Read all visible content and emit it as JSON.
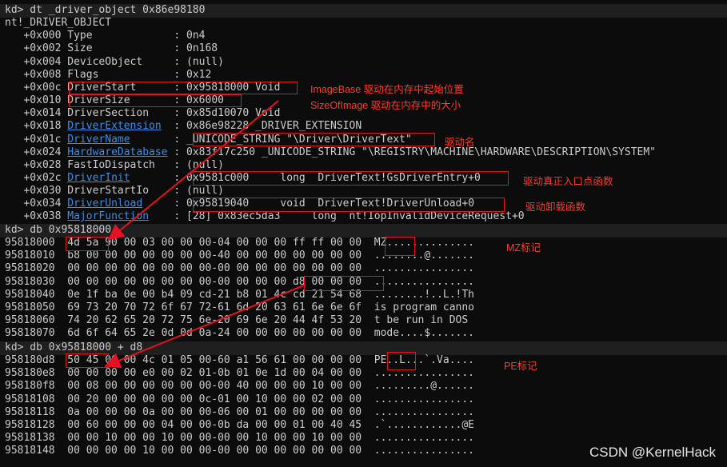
{
  "console": {
    "cmd1": "kd> dt _driver_object 0x86e98180",
    "struct_name": "nt!_DRIVER_OBJECT",
    "fields": [
      {
        "off": "+0x000",
        "name": "Type",
        "val": ": 0n4",
        "link": false
      },
      {
        "off": "+0x002",
        "name": "Size",
        "val": ": 0n168",
        "link": false
      },
      {
        "off": "+0x004",
        "name": "DeviceObject",
        "val": ": (null)",
        "link": false
      },
      {
        "off": "+0x008",
        "name": "Flags",
        "val": ": 0x12",
        "link": false
      },
      {
        "off": "+0x00c",
        "name": "DriverStart",
        "val": ": 0x95818000 Void",
        "link": false
      },
      {
        "off": "+0x010",
        "name": "DriverSize",
        "val": ": 0x6000",
        "link": false
      },
      {
        "off": "+0x014",
        "name": "DriverSection",
        "val": ": 0x85d10070 Void",
        "link": false
      },
      {
        "off": "+0x018",
        "name": "DriverExtension",
        "val": ": 0x86e98228 _DRIVER_EXTENSION",
        "link": true
      },
      {
        "off": "+0x01c",
        "name": "DriverName",
        "val": ": _UNICODE_STRING \"\\Driver\\DriverText\"",
        "link": true
      },
      {
        "off": "+0x024",
        "name": "HardwareDatabase",
        "val": ": 0x83f17c250 _UNICODE_STRING \"\\REGISTRY\\MACHINE\\HARDWARE\\DESCRIPTION\\SYSTEM\"",
        "link": true
      },
      {
        "off": "+0x028",
        "name": "FastIoDispatch",
        "val": ": (null)",
        "link": false
      },
      {
        "off": "+0x02c",
        "name": "DriverInit",
        "val": ": 0x9581c000     long  DriverText!GsDriverEntry+0",
        "link": true
      },
      {
        "off": "+0x030",
        "name": "DriverStartIo",
        "val": ": (null)",
        "link": false
      },
      {
        "off": "+0x034",
        "name": "DriverUnload",
        "val": ": 0x95819040     void  DriverText!DriverUnload+0",
        "link": true
      },
      {
        "off": "+0x038",
        "name": "MajorFunction",
        "val": ": [28] 0x83ec5da3     long  nt!IopInvalidDeviceRequest+0",
        "link": true
      }
    ],
    "cmd2": "kd> db 0x95818000",
    "dump1": [
      "95818000  4d 5a 90 00 03 00 00 00-04 00 00 00 ff ff 00 00  MZ..............",
      "95818010  b8 00 00 00 00 00 00 00-40 00 00 00 00 00 00 00  ........@.......",
      "95818020  00 00 00 00 00 00 00 00-00 00 00 00 00 00 00 00  ................",
      "95818030  00 00 00 00 00 00 00 00-00 00 00 00 d8 00 00 00  ................",
      "95818040  0e 1f ba 0e 00 b4 09 cd-21 b8 01 4c cd 21 54 68  ........!..L.!Th",
      "95818050  69 73 20 70 72 6f 67 72-61 6d 20 63 61 6e 6e 6f  is program canno",
      "95818060  74 20 62 65 20 72 75 6e-20 69 6e 20 44 4f 53 20  t be run in DOS ",
      "95818070  6d 6f 64 65 2e 0d 0d 0a-24 00 00 00 00 00 00 00  mode....$......."
    ],
    "cmd3": "kd> db 0x95818000 + d8",
    "dump2": [
      "958180d8  50 45 00 00 4c 01 05 00-60 a1 56 61 00 00 00 00  PE..L...`.Va....",
      "958180e8  00 00 00 00 e0 00 02 01-0b 01 0e 1d 00 04 00 00  ................",
      "958180f8  00 08 00 00 00 00 00 00-00 40 00 00 00 10 00 00  .........@......",
      "95818108  00 20 00 00 00 00 00 0c-01 00 10 00 00 02 00 00  ................",
      "95818118  0a 00 00 00 0a 00 00 00-06 00 01 00 00 00 00 00  ................",
      "95818128  00 60 00 00 00 04 00 00-0b da 00 00 01 00 40 45  .`............@E",
      "95818138  00 00 10 00 00 10 00 00-00 00 10 00 00 10 00 00  ................",
      "95818148  00 00 00 00 10 00 00 00-00 00 00 00 00 00 00 00  ................"
    ]
  },
  "annotations": {
    "image_base": "ImageBase 驱动在内存中起始位置",
    "size_of_image": "SizeOfImage 驱动在内存中的大小",
    "driver_name": "驱动名",
    "entry": "驱动真正入口点函数",
    "unload": "驱动卸载函数",
    "mz": "MZ标记",
    "pe": "PE标记"
  },
  "watermark": "CSDN @KernelHack",
  "colors": {
    "background": "#0c0c0c",
    "text": "#cccccc",
    "link": "#3b8eea",
    "highlight": "#e81123"
  }
}
